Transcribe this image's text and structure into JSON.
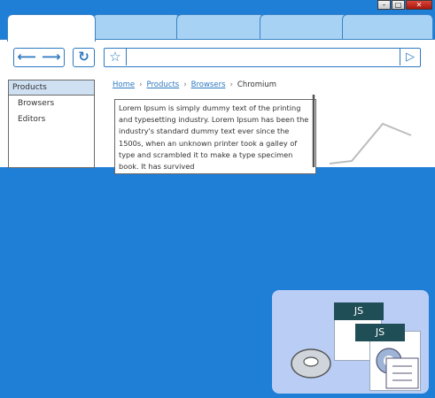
{
  "window": {
    "minimize_icon": "minimize-icon",
    "maximize_icon": "maximize-icon",
    "close_icon": "close-icon"
  },
  "toolbar": {
    "back_icon": "arrow-left-icon",
    "forward_icon": "arrow-right-icon",
    "reload_icon": "reload-icon",
    "bookmark_icon": "star-icon",
    "go_icon": "play-icon"
  },
  "sidebar": {
    "header": "Products",
    "items": [
      "Browsers",
      "Editors"
    ]
  },
  "breadcrumb": {
    "items": [
      "Home",
      "Products",
      "Browsers",
      "Chromium"
    ]
  },
  "content": {
    "text": "Lorem Ipsum is simply dummy text of the printing and typesetting industry. Lorem Ipsum has been the industry's standard dummy text ever since the 1500s, when an unknown printer took a galley of type and scrambled it to make a type specimen book. It has survived"
  },
  "taskbar_icon": {
    "badges": [
      "JS",
      "JS"
    ]
  },
  "colors": {
    "background": "#1f7ed6",
    "accent": "#2e79c0",
    "tab_inactive": "#a7d2f3",
    "icon_bg": "#b9cdf5"
  }
}
